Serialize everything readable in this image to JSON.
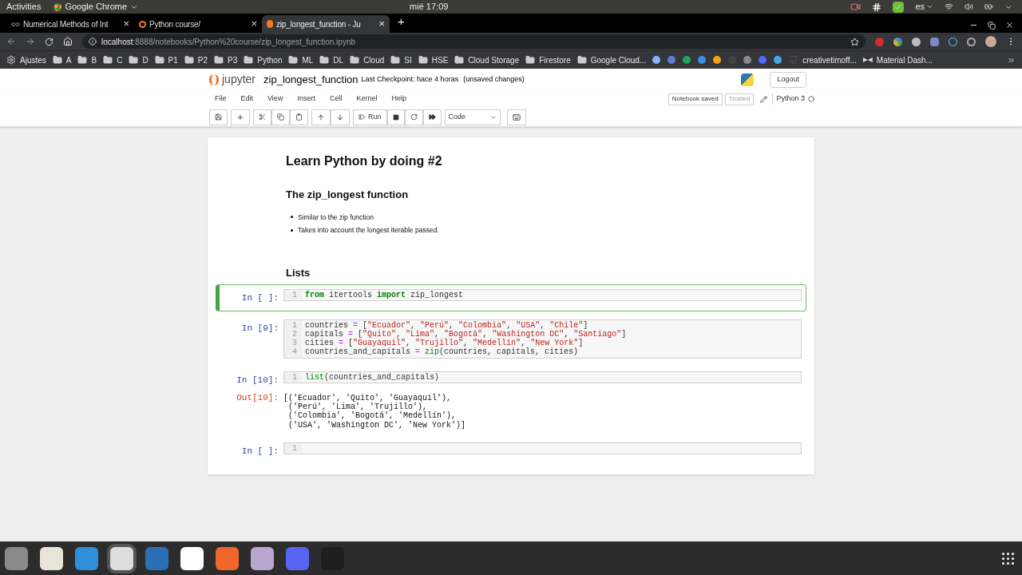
{
  "system_bar": {
    "activities": "Activities",
    "app": "Google Chrome",
    "clock": "mié 17:09",
    "language": "es"
  },
  "tabs": [
    {
      "label": "Numerical Methods of Int",
      "selected": false,
      "close": "×"
    },
    {
      "label": "Python course/",
      "selected": false,
      "close": "×"
    },
    {
      "label": "zip_longest_function - Ju",
      "selected": true,
      "close": "×"
    }
  ],
  "new_tab": "+",
  "address": {
    "host": "localhost",
    "path": ":8888/notebooks/Python%20course/zip_longest_function.ipynb"
  },
  "bookmarks": [
    {
      "label": "Ajustes",
      "kind": "gear"
    },
    {
      "label": "A",
      "kind": "folder"
    },
    {
      "label": "B",
      "kind": "folder"
    },
    {
      "label": "C",
      "kind": "folder"
    },
    {
      "label": "D",
      "kind": "folder"
    },
    {
      "label": "P1",
      "kind": "folder"
    },
    {
      "label": "P2",
      "kind": "folder"
    },
    {
      "label": "P3",
      "kind": "folder"
    },
    {
      "label": "Python",
      "kind": "folder"
    },
    {
      "label": "ML",
      "kind": "folder"
    },
    {
      "label": "DL",
      "kind": "folder"
    },
    {
      "label": "Cloud",
      "kind": "folder"
    },
    {
      "label": "SI",
      "kind": "folder"
    },
    {
      "label": "HSE",
      "kind": "folder"
    },
    {
      "label": "Cloud Storage",
      "kind": "folder"
    },
    {
      "label": "Firestore",
      "kind": "folder"
    },
    {
      "label": "Google Cloud...",
      "kind": "folder"
    },
    {
      "label": "creativetimoff...",
      "kind": "github"
    },
    {
      "label": "Material Dash...",
      "kind": "bow"
    }
  ],
  "jupyter": {
    "logo": "jupyter",
    "notebook_name": "zip_longest_function",
    "checkpoint": "Last Checkpoint: hace 4 horas",
    "unsaved": "(unsaved changes)",
    "logout": "Logout",
    "menu": [
      "File",
      "Edit",
      "View",
      "Insert",
      "Cell",
      "Kernel",
      "Help"
    ],
    "notebook_saved": "Notebook saved",
    "trusted": "Trusted",
    "kernel": "Python 3",
    "run": "Run",
    "cell_type": "Code"
  },
  "notebook": {
    "title": "Learn Python by doing #2",
    "subtitle": "The zip_longest function",
    "bullets": [
      "Similar to the zip function",
      "Takes into account the longest iterable passed."
    ],
    "section": "Lists",
    "cells": [
      {
        "prompt": "In [ ]:",
        "selected": true,
        "lines": [
          {
            "number": "1",
            "tokens": [
              {
                "kind": "kw",
                "text": "from"
              },
              {
                "kind": "plain",
                "text": " itertools "
              },
              {
                "kind": "kw",
                "text": "import"
              },
              {
                "kind": "plain",
                "text": " zip_longest"
              }
            ]
          }
        ]
      },
      {
        "prompt": "In [9]:",
        "selected": false,
        "lines": [
          {
            "number": "1",
            "tokens": [
              {
                "kind": "plain",
                "text": "countries "
              },
              {
                "kind": "op",
                "text": "="
              },
              {
                "kind": "plain",
                "text": " ["
              },
              {
                "kind": "str",
                "text": "\"Ecuador\""
              },
              {
                "kind": "plain",
                "text": ", "
              },
              {
                "kind": "str",
                "text": "\"Perú\""
              },
              {
                "kind": "plain",
                "text": ", "
              },
              {
                "kind": "str",
                "text": "\"Colombia\""
              },
              {
                "kind": "plain",
                "text": ", "
              },
              {
                "kind": "str",
                "text": "\"USA\""
              },
              {
                "kind": "plain",
                "text": ", "
              },
              {
                "kind": "str",
                "text": "\"Chile\""
              },
              {
                "kind": "plain",
                "text": "]"
              }
            ]
          },
          {
            "number": "2",
            "tokens": [
              {
                "kind": "plain",
                "text": "capitals "
              },
              {
                "kind": "op",
                "text": "="
              },
              {
                "kind": "plain",
                "text": " ["
              },
              {
                "kind": "str",
                "text": "\"Quito\""
              },
              {
                "kind": "plain",
                "text": ", "
              },
              {
                "kind": "str",
                "text": "\"Lima\""
              },
              {
                "kind": "plain",
                "text": ", "
              },
              {
                "kind": "str",
                "text": "\"Bogotá\""
              },
              {
                "kind": "plain",
                "text": ", "
              },
              {
                "kind": "str",
                "text": "\"Washington DC\""
              },
              {
                "kind": "plain",
                "text": ", "
              },
              {
                "kind": "str",
                "text": "\"Santiago\""
              },
              {
                "kind": "plain",
                "text": "]"
              }
            ]
          },
          {
            "number": "3",
            "tokens": [
              {
                "kind": "plain",
                "text": "cities "
              },
              {
                "kind": "op",
                "text": "="
              },
              {
                "kind": "plain",
                "text": " ["
              },
              {
                "kind": "str",
                "text": "\"Guayaquil\""
              },
              {
                "kind": "plain",
                "text": ", "
              },
              {
                "kind": "str",
                "text": "\"Trujillo\""
              },
              {
                "kind": "plain",
                "text": ", "
              },
              {
                "kind": "str",
                "text": "\"Medellín\""
              },
              {
                "kind": "plain",
                "text": ", "
              },
              {
                "kind": "str",
                "text": "\"New York\""
              },
              {
                "kind": "plain",
                "text": "]"
              }
            ]
          },
          {
            "number": "4",
            "tokens": [
              {
                "kind": "plain",
                "text": "countries_and_capitals "
              },
              {
                "kind": "op",
                "text": "= "
              },
              {
                "kind": "builtin",
                "text": "zip"
              },
              {
                "kind": "plain",
                "text": "(countries, capitals, cities)"
              }
            ]
          }
        ]
      },
      {
        "prompt": "In [10]:",
        "selected": false,
        "lines": [
          {
            "number": "1",
            "tokens": [
              {
                "kind": "builtin",
                "text": "list"
              },
              {
                "kind": "plain",
                "text": "(countries_and_capitals)"
              }
            ]
          }
        ],
        "out_prompt": "Out[10]:",
        "output": [
          "[('Ecuador', 'Quito', 'Guayaquil'),",
          " ('Perú', 'Lima', 'Trujillo'),",
          " ('Colombia', 'Bogotá', 'Medellín'),",
          " ('USA', 'Washington DC', 'New York')]"
        ]
      },
      {
        "prompt": "In [ ]:",
        "selected": false,
        "lines": [
          {
            "number": "1"
          }
        ]
      }
    ]
  }
}
